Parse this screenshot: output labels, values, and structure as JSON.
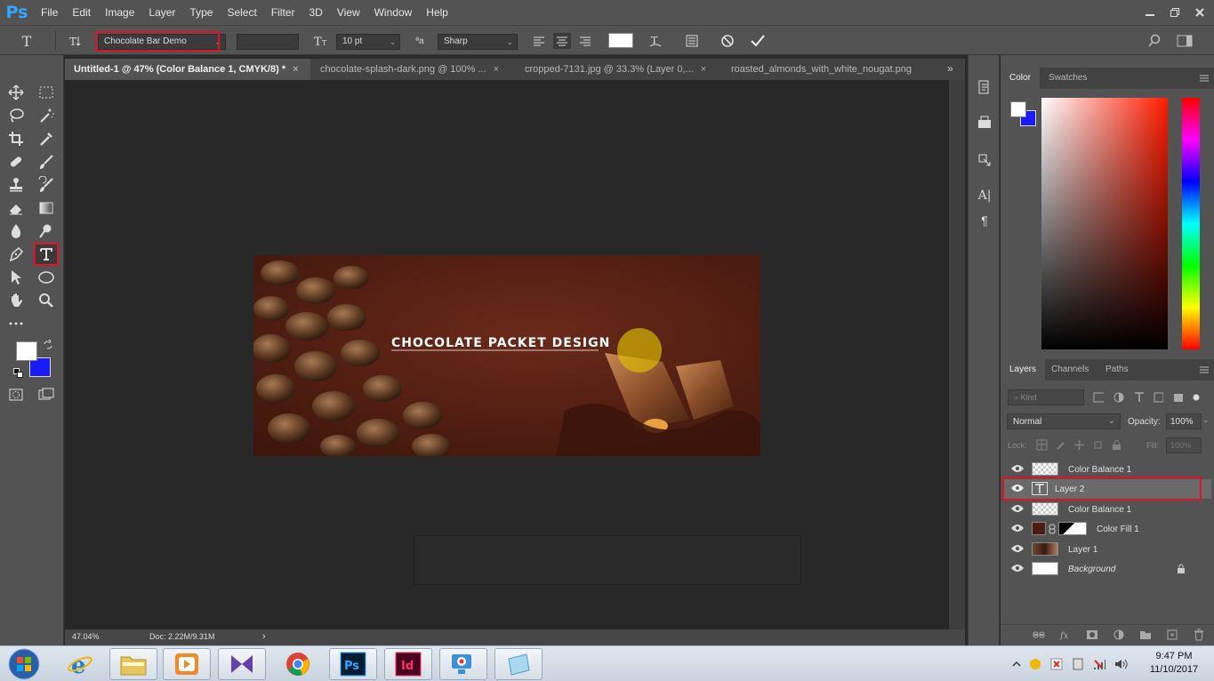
{
  "app": {
    "logo": "Ps"
  },
  "menu": [
    "File",
    "Edit",
    "Image",
    "Layer",
    "Type",
    "Select",
    "Filter",
    "3D",
    "View",
    "Window",
    "Help"
  ],
  "options": {
    "font_family": "Chocolate Bar Demo",
    "font_size": "10 pt",
    "antialias": "Sharp",
    "text_color": "#ffffff"
  },
  "tabs": [
    {
      "label": "Untitled-1 @ 47% (Color Balance 1, CMYK/8) *",
      "close": "×"
    },
    {
      "label": "chocolate-splash-dark.png @ 100% ...",
      "close": "×"
    },
    {
      "label": "cropped-7131.jpg @ 33.3% (Layer 0,...",
      "close": "×"
    },
    {
      "label": "roasted_almonds_with_white_nougat.png",
      "close": ""
    }
  ],
  "canvas": {
    "headline": "CHOCOLATE PACKET DESIGN"
  },
  "status": {
    "zoom": "47.04%",
    "doc": "Doc: 2.22M/9.31M",
    "arrow": "›"
  },
  "color_panel": {
    "tabs": [
      "Color",
      "Swatches"
    ],
    "fg": "#ffffff",
    "bg": "#1a1aff"
  },
  "layers_panel": {
    "tabs": [
      "Layers",
      "Channels",
      "Paths"
    ],
    "filter_placeholder": "Kind",
    "blend_mode": "Normal",
    "opacity_label": "Opacity:",
    "opacity": "100%",
    "lock_label": "Lock:",
    "fill_label": "Fill:",
    "fill": "100%",
    "layers": [
      {
        "name": "Color Balance 1",
        "kind": "adjustment"
      },
      {
        "name": "Layer 2",
        "kind": "text"
      },
      {
        "name": "Color Balance 1",
        "kind": "adjustment"
      },
      {
        "name": "Color Fill 1",
        "kind": "fill"
      },
      {
        "name": "Layer 1",
        "kind": "image"
      },
      {
        "name": "Background",
        "kind": "background"
      }
    ]
  },
  "taskbar": {
    "time": "9:47 PM",
    "date": "11/10/2017",
    "apps": [
      "internet-explorer",
      "file-explorer",
      "media-player",
      "visual-studio",
      "chrome",
      "photoshop",
      "indesign",
      "camtasia",
      "notes"
    ]
  },
  "colors": {
    "highlight": "#e0112b",
    "ps_blue": "#31a8ff",
    "panel": "#535353",
    "canvas": "#282828"
  }
}
